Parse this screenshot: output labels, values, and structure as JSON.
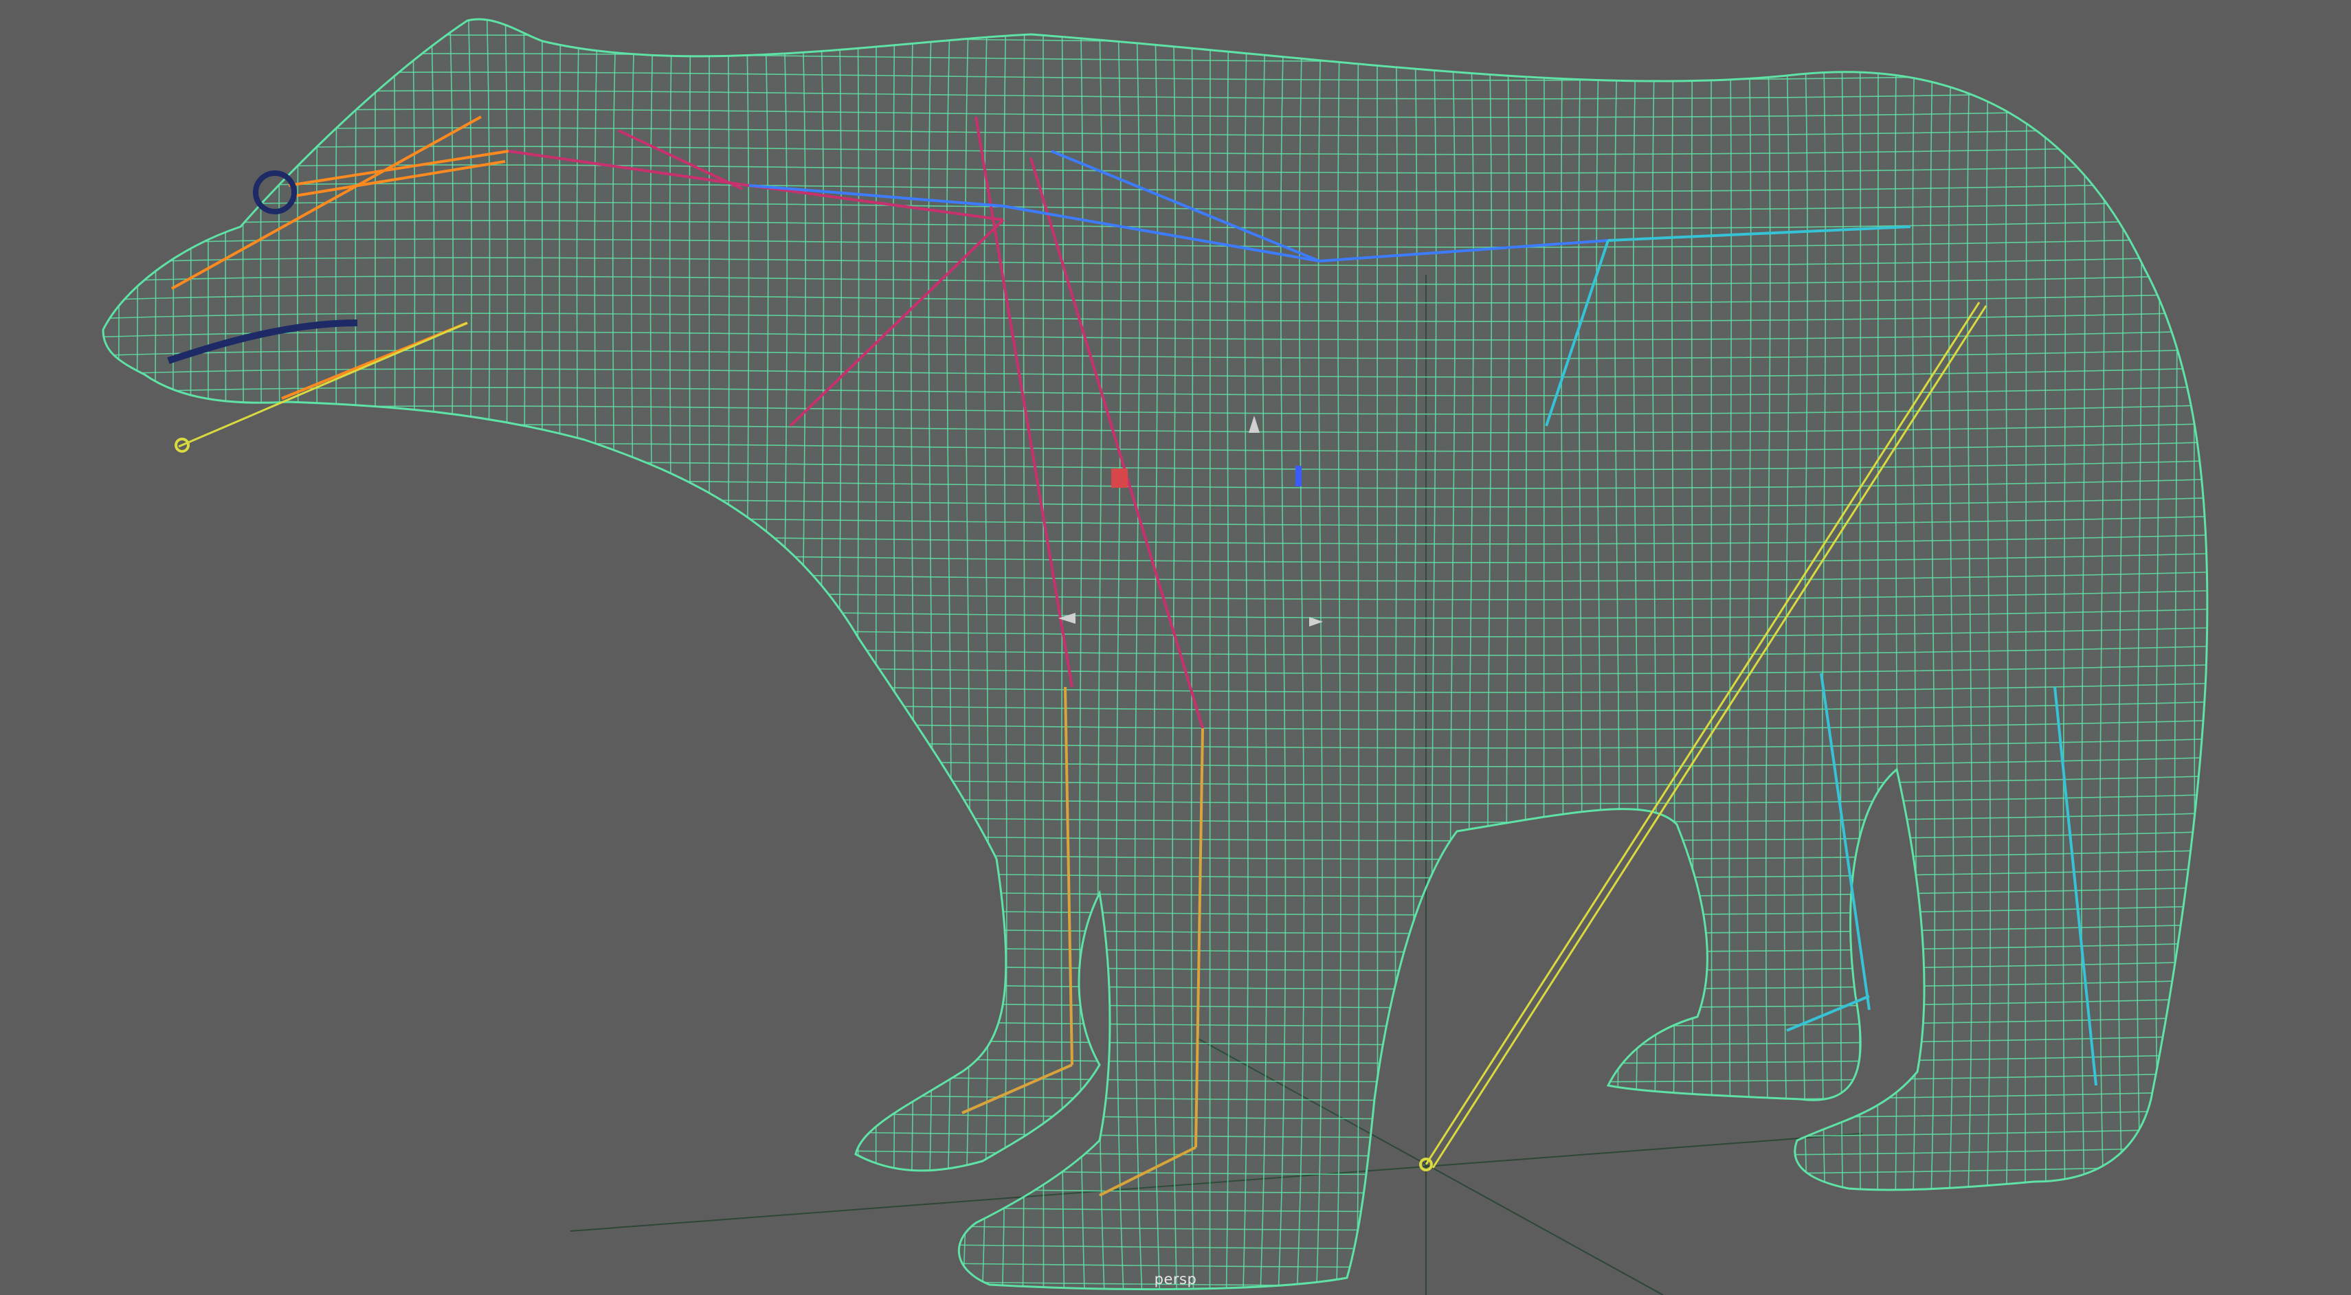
{
  "viewport": {
    "camera_label": "persp",
    "background": "#5d5d5d",
    "wire_color": "#5fe2a6",
    "grid_axis_color": "#2f4a3a",
    "object": "polar-bear",
    "display_mode": "wireframe"
  },
  "rig": {
    "joint_colors": {
      "head": "#ff8a1f",
      "neck": "#c8306e",
      "spine": "#3d7bff",
      "hind": "#36c3d6",
      "front_leg": "#d9a43b",
      "ik_handle": "#d9d940"
    },
    "gizmo_colors": {
      "y_axis": "#d0d0d0",
      "pivot": "#d9464a",
      "z_axis": "#3d5cff"
    }
  }
}
